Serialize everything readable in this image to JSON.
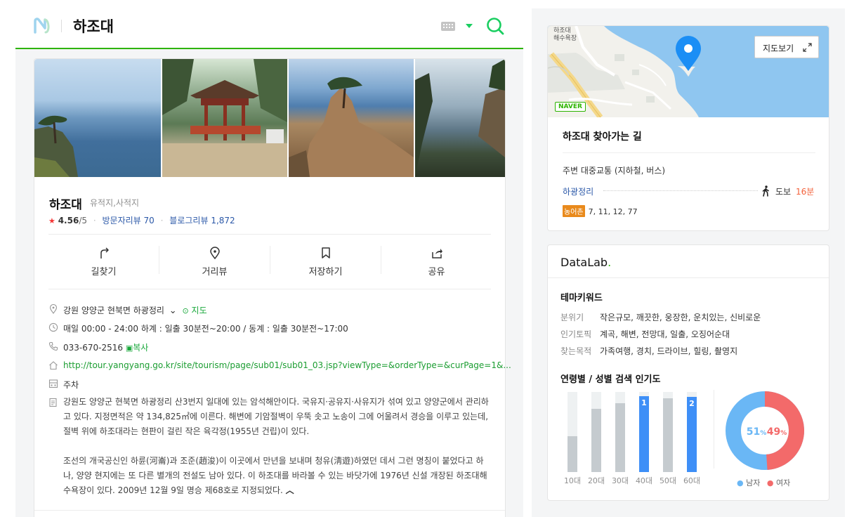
{
  "header": {
    "title": "하조대"
  },
  "place": {
    "name": "하조대",
    "category": "유적지,사적지",
    "rating_star": "★",
    "rating": "4.56",
    "rating_total": "/5",
    "visitor_review_label": "방문자리뷰",
    "visitor_review_count": "70",
    "blog_review_label": "블로그리뷰",
    "blog_review_count": "1,872"
  },
  "actions": [
    {
      "label": "길찾기",
      "icon": "directions-icon"
    },
    {
      "label": "거리뷰",
      "icon": "street-view-icon"
    },
    {
      "label": "저장하기",
      "icon": "bookmark-icon"
    },
    {
      "label": "공유",
      "icon": "share-icon"
    }
  ],
  "info": {
    "address": "강원 양양군 현북면 하광정리",
    "map_link": "지도",
    "hours": "매일 00:00 - 24:00 하계 : 일출 30분전~20:00 / 동계 : 일출 30분전~17:00",
    "phone": "033-670-2516",
    "copy_label": "복사",
    "url": "http://tour.yangyang.go.kr/site/tourism/page/sub01/sub01_03.jsp?viewType=&orderType=&curPage=1&...",
    "parking": "주차",
    "description_1": "강원도 양양군 현북면 하광정리 산3번지 일대에 있는 암석해안이다. 국유지·공유지·사유지가 섞여 있고 양양군에서 관리하고 있다. 지정면적은 약 134,825㎡에 이른다. 해변에 기암절벽이 우뚝 솟고 노송이 그에 어울려서 경승을 이루고 있는데, 절벽 위에 하조대라는 현판이 걸린 작은 육각정(1955년 건립)이 있다.",
    "description_2": "조선의 개국공신인 하륜(河崙)과 조준(趙浚)이 이곳에서 만년을 보내며 청유(淸遊)하였던 데서 그런 명칭이 붙었다고 하나, 양양 현지에는 또 다른 별개의 전설도 남아 있다. 이 하조대를 바라볼 수 있는 바닷가에 1976년 신설 개장된 하조대해수욕장이 있다. 2009년 12월 9일 명승 제68호로 지정되었다."
  },
  "map": {
    "view_button": "지도보기",
    "place_label_1": "하조대",
    "place_label_2": "해수욕장",
    "brand": "NAVER"
  },
  "route": {
    "title": "하조대 찾아가는 길",
    "transit_heading": "주변 대중교통 (지하철, 버스)",
    "stop_name": "하광정리",
    "walk_label": "도보",
    "walk_time": "16분",
    "bus_badge": "농어촌",
    "bus_numbers": "7, 11, 12, 77"
  },
  "datalab": {
    "brand": "DataLab",
    "brand_dot": ".",
    "theme_title": "테마키워드",
    "keywords": [
      {
        "key": "분위기",
        "value": "작은규모, 깨끗한, 웅장한, 운치있는, 신비로운"
      },
      {
        "key": "인기토픽",
        "value": "계곡, 해변, 전망대, 일출, 오징어순대"
      },
      {
        "key": "찾는목적",
        "value": "가족여행, 경치, 드라이브, 힐링, 촬영지"
      }
    ],
    "popularity_title": "연령별 / 성별 검색 인기도",
    "age_groups": [
      {
        "label": "10대",
        "value": 0.45,
        "rank": ""
      },
      {
        "label": "20대",
        "value": 0.79,
        "rank": ""
      },
      {
        "label": "30대",
        "value": 0.86,
        "rank": ""
      },
      {
        "label": "40대",
        "value": 0.95,
        "rank": "1"
      },
      {
        "label": "50대",
        "value": 0.92,
        "rank": ""
      },
      {
        "label": "60대",
        "value": 0.94,
        "rank": "2"
      }
    ],
    "gender": {
      "male_pct": 51,
      "female_pct": 49,
      "male_value": "51",
      "female_value": "49",
      "pct_unit": "%",
      "male_label": "남자",
      "female_label": "여자",
      "male_color": "#6ab7f5",
      "female_color": "#f36a6a"
    }
  },
  "colors": {
    "brand_green": "#2db400",
    "link_blue": "#2b58a8",
    "rank_blue": "#3e8ff7",
    "star_red": "#f53535"
  }
}
